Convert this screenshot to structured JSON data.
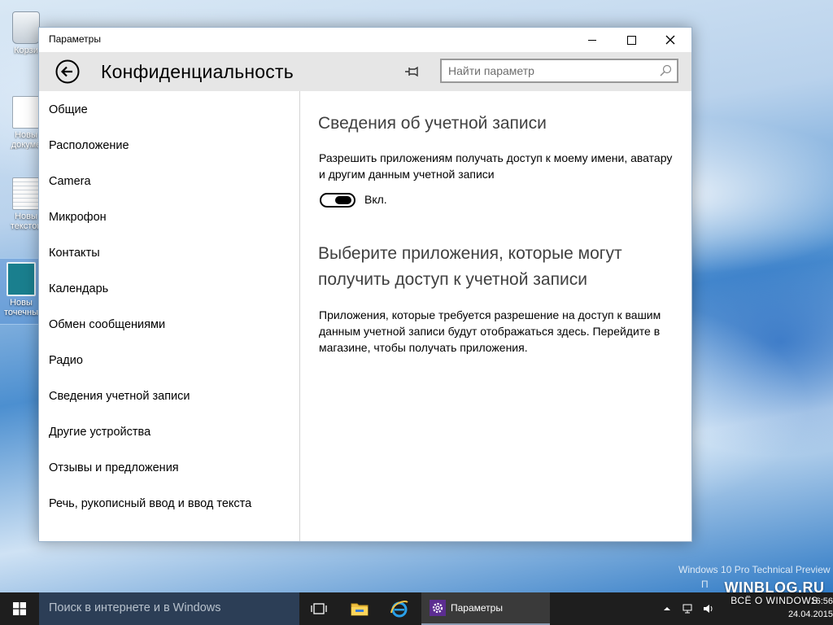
{
  "desktop": {
    "icons": [
      {
        "line1": "Корзи",
        "line2": ""
      },
      {
        "line1": "Новы",
        "line2": "докуме"
      },
      {
        "line1": "Новы",
        "line2": "текстов"
      },
      {
        "line1": "Новы",
        "line2": "точечны"
      }
    ],
    "watermark": "Windows 10 Pro Technical Preview",
    "watermark_line2": "П",
    "brand": {
      "name": "WINBLOG.RU",
      "tagline": "ВСЁ О WINDOWS"
    }
  },
  "window": {
    "title": "Параметры",
    "page_title": "Конфиденциальность",
    "search_placeholder": "Найти параметр",
    "search_value": ""
  },
  "sidebar": {
    "items": [
      {
        "label": "Общие"
      },
      {
        "label": "Расположение"
      },
      {
        "label": "Camera"
      },
      {
        "label": "Микрофон"
      },
      {
        "label": "Контакты"
      },
      {
        "label": "Календарь"
      },
      {
        "label": "Обмен сообщениями"
      },
      {
        "label": "Радио"
      },
      {
        "label": "Сведения учетной записи"
      },
      {
        "label": "Другие устройства"
      },
      {
        "label": "Отзывы и предложения"
      },
      {
        "label": "Речь, рукописный ввод и ввод текста"
      }
    ]
  },
  "content": {
    "section1_heading": "Сведения об учетной записи",
    "section1_desc": "Разрешить приложениям получать доступ к моему имени, аватару и другим данным учетной записи",
    "toggle_state": "on",
    "toggle_label": "Вкл.",
    "section2_heading": "Выберите приложения, которые могут получить доступ к учетной записи",
    "section2_desc": "Приложения, которые требуется разрешение на доступ к вашим данным учетной записи будут отображаться здесь. Перейдите в магазине, чтобы получать приложения."
  },
  "taskbar": {
    "search_placeholder": "Поиск в интернете и в Windows",
    "active_app_label": "Параметры",
    "time": "16:56",
    "date": "24.04.2015"
  },
  "colors": {
    "taskbar": "#1e1e1e",
    "taskbar_search": "#2c3e56",
    "settings_icon_bg": "#5c2d91",
    "header_bg": "#e6e6e6"
  }
}
